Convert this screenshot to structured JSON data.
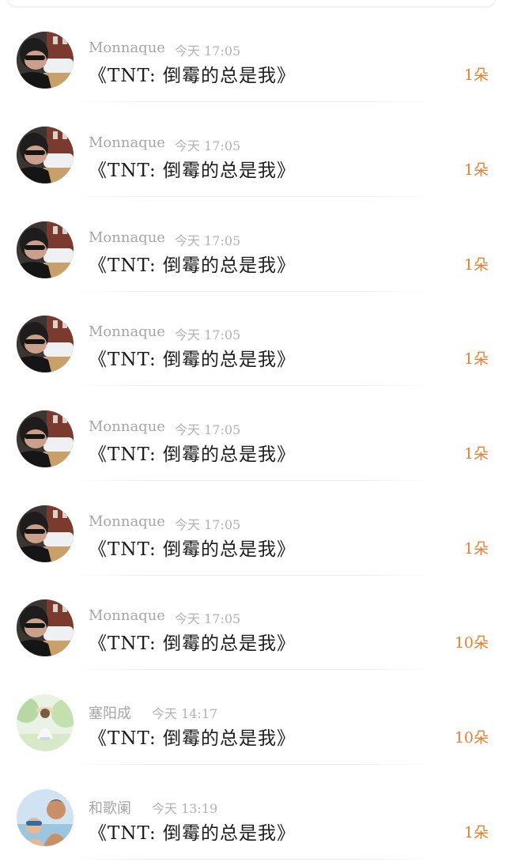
{
  "gifts": [
    {
      "user": "Monnaque",
      "time": "今天 17:05",
      "title": "《TNT: 倒霉的总是我》",
      "count": "1朵",
      "avatar_icon": "man-with-car-avatar"
    },
    {
      "user": "Monnaque",
      "time": "今天 17:05",
      "title": "《TNT: 倒霉的总是我》",
      "count": "1朵",
      "avatar_icon": "man-with-car-avatar"
    },
    {
      "user": "Monnaque",
      "time": "今天 17:05",
      "title": "《TNT: 倒霉的总是我》",
      "count": "1朵",
      "avatar_icon": "man-with-car-avatar"
    },
    {
      "user": "Monnaque",
      "time": "今天 17:05",
      "title": "《TNT: 倒霉的总是我》",
      "count": "1朵",
      "avatar_icon": "man-with-car-avatar"
    },
    {
      "user": "Monnaque",
      "time": "今天 17:05",
      "title": "《TNT: 倒霉的总是我》",
      "count": "1朵",
      "avatar_icon": "man-with-car-avatar"
    },
    {
      "user": "Monnaque",
      "time": "今天 17:05",
      "title": "《TNT: 倒霉的总是我》",
      "count": "1朵",
      "avatar_icon": "man-with-car-avatar"
    },
    {
      "user": "Monnaque",
      "time": "今天 17:05",
      "title": "《TNT: 倒霉的总是我》",
      "count": "10朵",
      "avatar_icon": "man-with-car-avatar"
    },
    {
      "user": "塞阳成",
      "time": "今天 14:17",
      "title": "《TNT: 倒霉的总是我》",
      "count": "10朵",
      "avatar_icon": "girl-in-garden-avatar"
    },
    {
      "user": "和歌阑",
      "time": "今天 13:19",
      "title": "《TNT: 倒霉的总是我》",
      "count": "1朵",
      "avatar_icon": "man-with-child-avatar"
    }
  ],
  "colors": {
    "accent": "#f07d2c",
    "name": "#a6a6a6",
    "time": "#b3b3b3",
    "title": "#1c1c1c"
  }
}
